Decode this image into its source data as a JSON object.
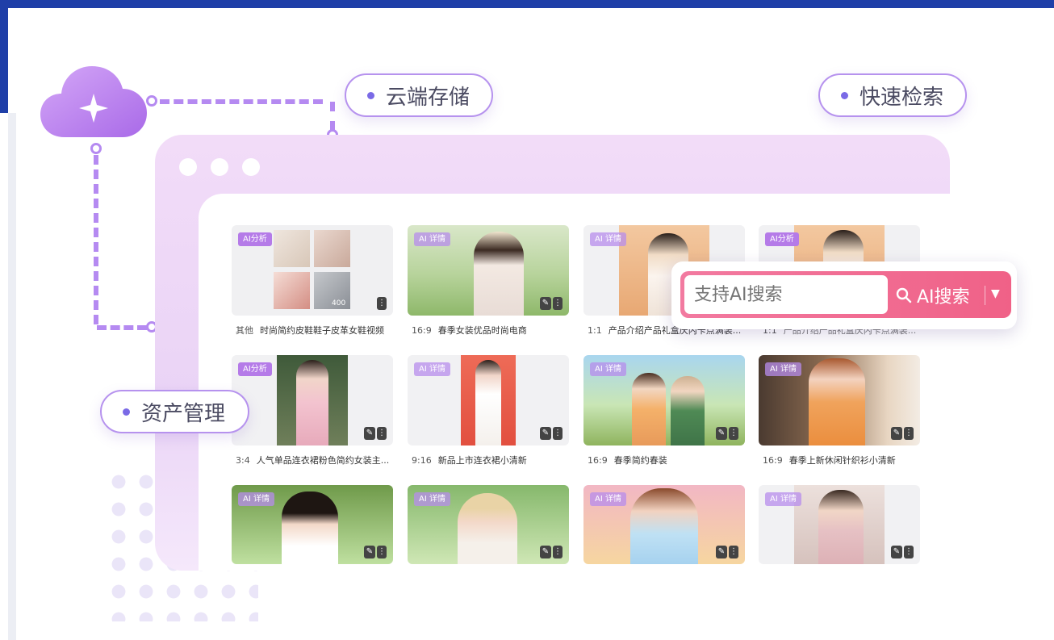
{
  "features": {
    "cloud": "云端存储",
    "search": "快速检索",
    "asset": "资产管理"
  },
  "search": {
    "placeholder": "支持AI搜索",
    "button_label": "AI搜索"
  },
  "badges": {
    "ai_analysis": "AI分析",
    "ai_detail": "详情",
    "ai_mark": "AI"
  },
  "thumb_count": "400",
  "cards": [
    {
      "ratio": "其他",
      "title": "时尚简约皮鞋鞋子皮革女鞋视频",
      "badge": "AI分析"
    },
    {
      "ratio": "16:9",
      "title": "春季女装优品时尚电商",
      "badge": "详情"
    },
    {
      "ratio": "1:1",
      "title": "产品介绍产品礼盒庆内卡点满装...",
      "badge": "详情"
    },
    {
      "ratio": "1:1",
      "title": "产品介绍产品礼盒庆内卡点满装...",
      "badge": "AI分析"
    },
    {
      "ratio": "3:4",
      "title": "人气单品连衣裙粉色简约女装主...",
      "badge": "AI分析"
    },
    {
      "ratio": "9:16",
      "title": "新品上市连衣裙小清新",
      "badge": "详情"
    },
    {
      "ratio": "16:9",
      "title": "春季简约春装",
      "badge": "详情"
    },
    {
      "ratio": "16:9",
      "title": "春季上新休闲针织衫小清新",
      "badge": "详情"
    },
    {
      "ratio": "",
      "title": "",
      "badge": "详情"
    },
    {
      "ratio": "",
      "title": "",
      "badge": "详情"
    },
    {
      "ratio": "",
      "title": "",
      "badge": "详情"
    },
    {
      "ratio": "",
      "title": "",
      "badge": "详情"
    }
  ],
  "colors": {
    "frame_blue": "#1f3fa8",
    "accent_purple": "#b58af1",
    "search_pink": "#f06187"
  }
}
